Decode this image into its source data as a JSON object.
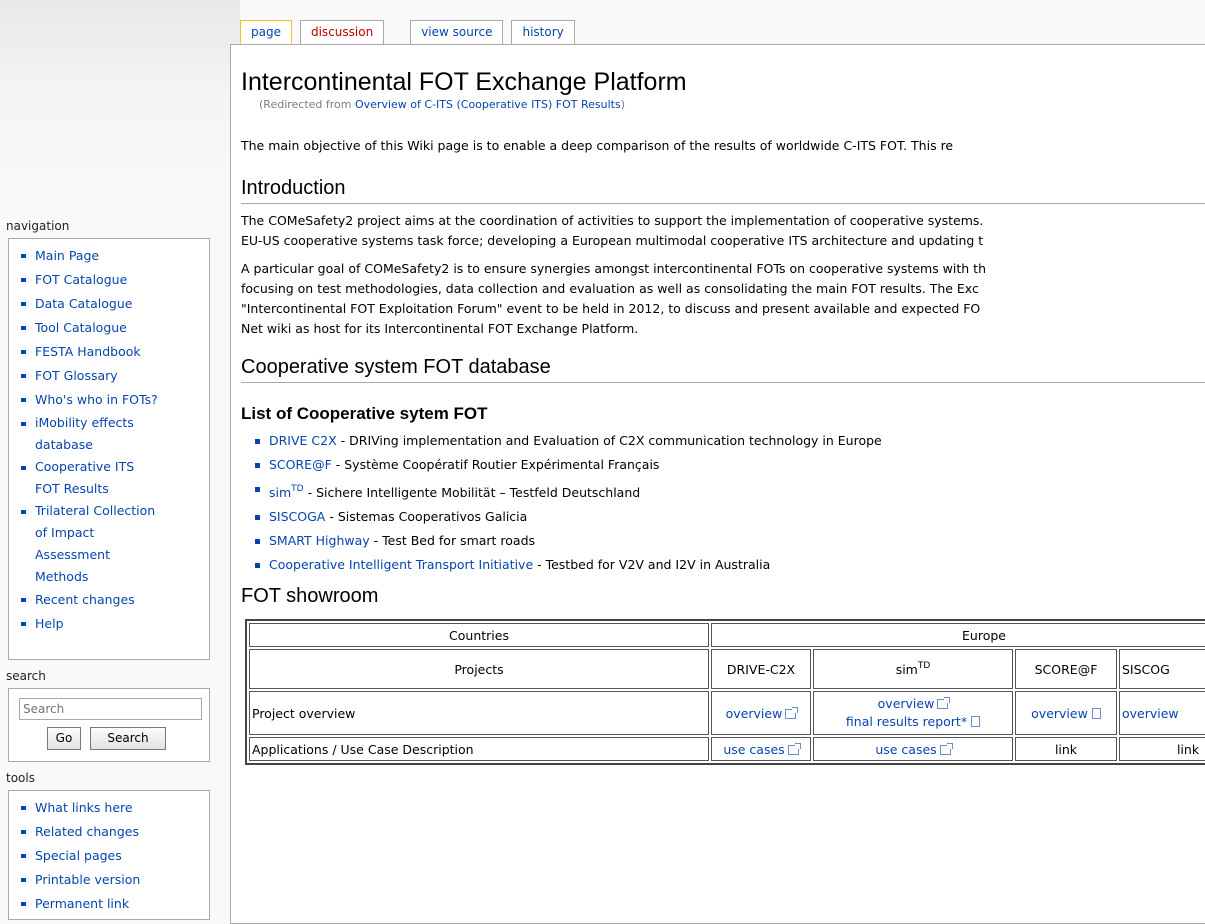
{
  "tabs": [
    {
      "label": "page"
    },
    {
      "label": "discussion"
    },
    {
      "label": "view source"
    },
    {
      "label": "history"
    }
  ],
  "title": "Intercontinental FOT Exchange Platform",
  "redirect": {
    "prefix": "(Redirected from ",
    "link": "Overview of C-ITS (Cooperative ITS) FOT Results",
    "suffix": ")"
  },
  "intro": "The main objective of this Wiki page is to enable a deep comparison of the results of worldwide C-ITS FOT. This re",
  "sections": {
    "introduction": {
      "heading": "Introduction",
      "p1_line1": "The COMeSafety2 project aims at the coordination of activities to support the implementation of cooperative systems.",
      "p1_line2": "EU-US cooperative systems task force; developing a European multimodal cooperative ITS architecture and updating t",
      "p2_line1": "A particular goal of COMeSafety2 is to ensure synergies amongst intercontinental FOTs on cooperative systems with th",
      "p2_line2": "focusing on test methodologies, data collection and evaluation as well as consolidating the main FOT results. The Exc",
      "p2_line3": "\"Intercontinental FOT Exploitation Forum\" event to be held in 2012, to discuss and present available and expected FO",
      "p2_line4": "Net wiki as host for its Intercontinental FOT Exchange Platform."
    },
    "database": {
      "heading": "Cooperative system FOT database"
    },
    "list": {
      "heading": "List of Cooperative sytem FOT",
      "items": [
        {
          "name": "DRIVE C2X",
          "desc": " - DRIVing implementation and Evaluation of C2X communication technology in Europe"
        },
        {
          "name": "SCORE@F",
          "desc": " - Système Coopératif Routier Expérimental Français"
        },
        {
          "name": "sim",
          "sup": "TD",
          "desc": " - Sichere Intelligente Mobilität – Testfeld Deutschland"
        },
        {
          "name": "SISCOGA",
          "desc": " - Sistemas Cooperativos Galicia"
        },
        {
          "name": "SMART Highway",
          "desc": " - Test Bed for smart roads"
        },
        {
          "name": "Cooperative Intelligent Transport Initiative",
          "desc": " - Testbed for V2V and I2V in Australia"
        }
      ]
    },
    "showroom": {
      "heading": "FOT showroom",
      "row_countries": {
        "label": "Countries",
        "region": "Europe"
      },
      "row_projects": {
        "label": "Projects",
        "p1": "DRIVE-C2X",
        "p2": "sim",
        "p2_sup": "TD",
        "p3": "SCORE@F",
        "p4": "SISCOG"
      },
      "row_overview": {
        "label": "Project overview",
        "c1": "overview",
        "c2a": "overview",
        "c2b": "final results report*",
        "c3": "overview",
        "c4": "overview"
      },
      "row_usecases": {
        "label": "Applications / Use Case Description",
        "c1": "use cases",
        "c2": "use cases",
        "c3": "link",
        "c4": "link"
      }
    }
  },
  "sidebar": {
    "navigation": {
      "title": "navigation",
      "items": [
        "Main Page",
        "FOT Catalogue",
        "Data Catalogue",
        "Tool Catalogue",
        "FESTA Handbook",
        "FOT Glossary",
        "Who's who in FOTs?"
      ],
      "imobility_1": "iMobility effects",
      "imobility_2": "database",
      "coop_1": "Cooperative ITS",
      "coop_2": "FOT Results",
      "tri_1": "Trilateral Collection",
      "tri_2": "of Impact",
      "tri_3": "Assessment",
      "tri_4": "Methods",
      "recent": "Recent changes",
      "help": "Help"
    },
    "search": {
      "title": "search",
      "placeholder": "Search",
      "go": "Go",
      "search": "Search"
    },
    "tools": {
      "title": "tools",
      "items": [
        "What links here",
        "Related changes",
        "Special pages",
        "Printable version",
        "Permanent link"
      ]
    }
  }
}
